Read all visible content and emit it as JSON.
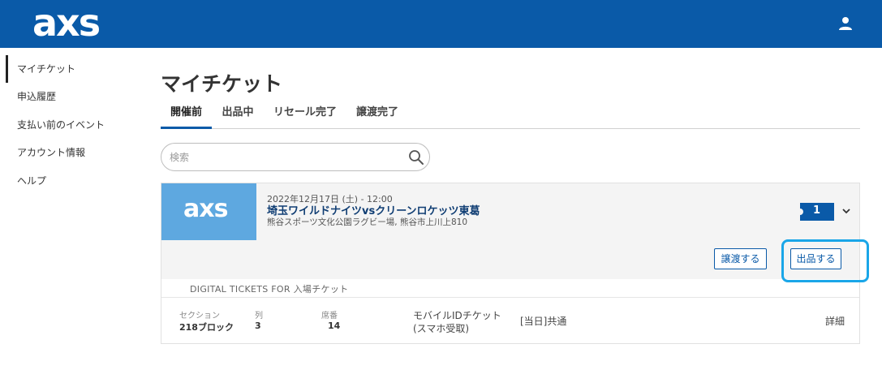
{
  "header": {
    "logo": "axs",
    "user_icon": "user-icon"
  },
  "sidebar": {
    "items": [
      {
        "label": "マイチケット",
        "active": true
      },
      {
        "label": "申込履歴"
      },
      {
        "label": "支払い前のイベント"
      },
      {
        "label": "アカウント情報"
      },
      {
        "label": "ヘルプ"
      }
    ]
  },
  "page": {
    "title": "マイチケット"
  },
  "tabs": [
    {
      "label": "開催前",
      "active": true
    },
    {
      "label": "出品中"
    },
    {
      "label": "リセール完了"
    },
    {
      "label": "譲渡完了"
    }
  ],
  "search": {
    "placeholder": "検索",
    "value": ""
  },
  "event": {
    "thumb_logo": "axs",
    "date": "2022年12月17日 (土) - 12:00",
    "title": "埼玉ワイルドナイツvsクリーンロケッツ東葛",
    "venue": "熊谷スポーツ文化公園ラグビー場, 熊谷市上川上810",
    "ticket_count": "1",
    "transfer_button": "譲渡する",
    "sell_button": "出品する",
    "digital_label": "DIGITAL TICKETS FOR 入場チケット",
    "ticket": {
      "section_label": "セクション",
      "section_value": "218ブロック",
      "row_label": "列",
      "row_value": "3",
      "seat_label": "席番",
      "seat_value": "14",
      "delivery_line1": "モバイルIDチケット",
      "delivery_line2": "(スマホ受取)",
      "type": "[当日]共通",
      "details_link": "詳細"
    }
  },
  "colors": {
    "brand": "#0a5aa8",
    "highlight": "#1aa6e8",
    "thumb_bg": "#5ea8e0"
  }
}
